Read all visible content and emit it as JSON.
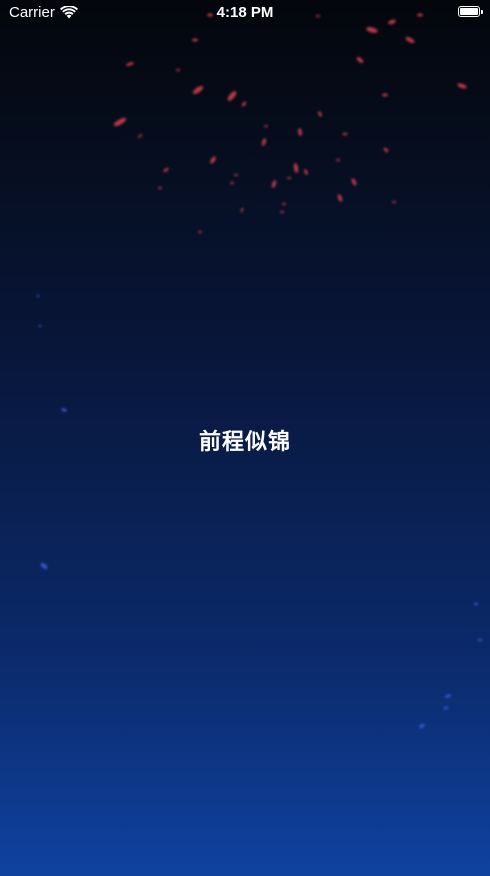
{
  "status_bar": {
    "carrier": "Carrier",
    "time": "4:18 PM",
    "icons": [
      "wifi-icon",
      "battery-icon"
    ]
  },
  "main": {
    "title": "前程似锦"
  },
  "colors": {
    "background_top": "#04060c",
    "background_bottom": "#0f42a0",
    "spark_red": "#e0424f",
    "spark_blue": "#4a6cff",
    "text": "#ffffff"
  }
}
